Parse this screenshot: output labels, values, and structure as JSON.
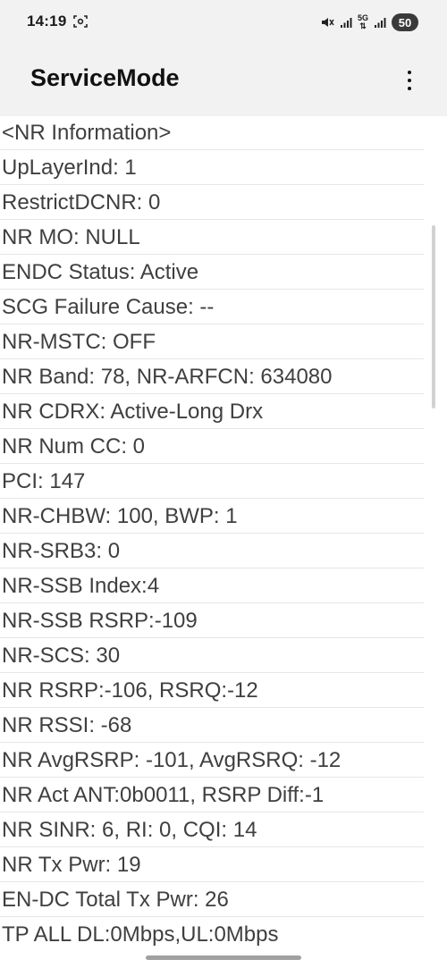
{
  "status_bar": {
    "time": "14:19",
    "network_label": "5G",
    "battery": "50",
    "icons": [
      "screenshot-icon",
      "mute-vibrate-icon",
      "signal-icon",
      "signal-icon",
      "battery-icon"
    ]
  },
  "app_bar": {
    "title": "ServiceMode",
    "menu_icon": "more-vert-icon"
  },
  "lines": [
    "<NR Information>",
    "UpLayerInd: 1",
    "RestrictDCNR: 0",
    "NR MO: NULL",
    "ENDC Status: Active",
    "SCG Failure Cause: --",
    "NR-MSTC: OFF",
    "NR Band: 78, NR-ARFCN: 634080",
    "NR CDRX: Active-Long Drx",
    "NR Num CC: 0",
    "PCI: 147",
    "NR-CHBW: 100, BWP: 1",
    "NR-SRB3: 0",
    "NR-SSB Index:4",
    "NR-SSB RSRP:-109",
    "NR-SCS: 30",
    "NR RSRP:-106, RSRQ:-12",
    "NR RSSI: -68",
    "NR AvgRSRP: -101, AvgRSRQ: -12",
    "NR Act ANT:0b0011, RSRP Diff:-1",
    "NR SINR: 6, RI: 0, CQI: 14",
    "NR Tx Pwr: 19",
    "EN-DC Total Tx Pwr: 26",
    "TP ALL DL:0Mbps,UL:0Mbps"
  ]
}
